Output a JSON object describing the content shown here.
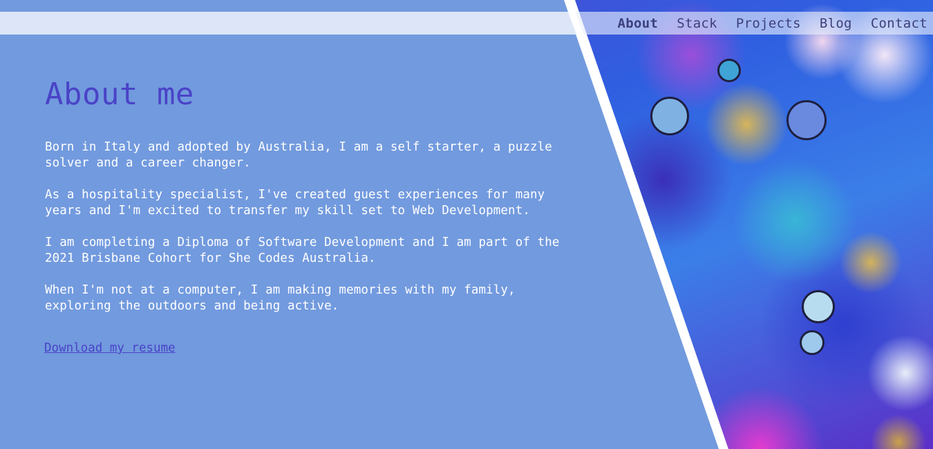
{
  "nav": {
    "items": [
      {
        "label": "About",
        "active": true
      },
      {
        "label": "Stack",
        "active": false
      },
      {
        "label": "Projects",
        "active": false
      },
      {
        "label": "Blog",
        "active": false
      },
      {
        "label": "Contact",
        "active": false
      }
    ]
  },
  "main": {
    "title": "About me",
    "paragraphs": [
      "Born in Italy and adopted by Australia, I am a self starter, a puzzle solver and a career changer.",
      "As a hospitality specialist, I've created guest experiences for many years and I'm excited to transfer my skill set to Web Development.",
      "I am completing a Diploma of Software Development and I am part of the 2021 Brisbane Cohort for She Codes Australia.",
      "When I'm not at a computer, I am making memories with my family, exploring the outdoors and being active."
    ],
    "resume_link": "Download my resume"
  },
  "colors": {
    "background": "#729ade",
    "heading": "#4a43c7",
    "nav_text": "#3d3f7a",
    "body_text": "#ffffff"
  }
}
